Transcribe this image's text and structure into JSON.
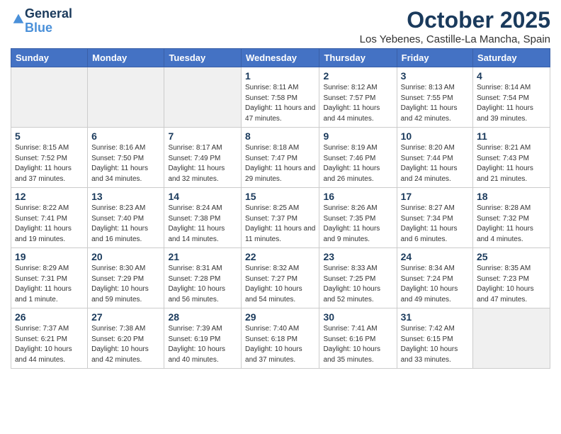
{
  "header": {
    "logo_line1": "General",
    "logo_line2": "Blue",
    "month": "October 2025",
    "location": "Los Yebenes, Castille-La Mancha, Spain"
  },
  "weekdays": [
    "Sunday",
    "Monday",
    "Tuesday",
    "Wednesday",
    "Thursday",
    "Friday",
    "Saturday"
  ],
  "weeks": [
    [
      {
        "day": "",
        "sunrise": "",
        "sunset": "",
        "daylight": "",
        "empty": true
      },
      {
        "day": "",
        "sunrise": "",
        "sunset": "",
        "daylight": "",
        "empty": true
      },
      {
        "day": "",
        "sunrise": "",
        "sunset": "",
        "daylight": "",
        "empty": true
      },
      {
        "day": "1",
        "sunrise": "Sunrise: 8:11 AM",
        "sunset": "Sunset: 7:58 PM",
        "daylight": "Daylight: 11 hours and 47 minutes.",
        "empty": false
      },
      {
        "day": "2",
        "sunrise": "Sunrise: 8:12 AM",
        "sunset": "Sunset: 7:57 PM",
        "daylight": "Daylight: 11 hours and 44 minutes.",
        "empty": false
      },
      {
        "day": "3",
        "sunrise": "Sunrise: 8:13 AM",
        "sunset": "Sunset: 7:55 PM",
        "daylight": "Daylight: 11 hours and 42 minutes.",
        "empty": false
      },
      {
        "day": "4",
        "sunrise": "Sunrise: 8:14 AM",
        "sunset": "Sunset: 7:54 PM",
        "daylight": "Daylight: 11 hours and 39 minutes.",
        "empty": false
      }
    ],
    [
      {
        "day": "5",
        "sunrise": "Sunrise: 8:15 AM",
        "sunset": "Sunset: 7:52 PM",
        "daylight": "Daylight: 11 hours and 37 minutes.",
        "empty": false
      },
      {
        "day": "6",
        "sunrise": "Sunrise: 8:16 AM",
        "sunset": "Sunset: 7:50 PM",
        "daylight": "Daylight: 11 hours and 34 minutes.",
        "empty": false
      },
      {
        "day": "7",
        "sunrise": "Sunrise: 8:17 AM",
        "sunset": "Sunset: 7:49 PM",
        "daylight": "Daylight: 11 hours and 32 minutes.",
        "empty": false
      },
      {
        "day": "8",
        "sunrise": "Sunrise: 8:18 AM",
        "sunset": "Sunset: 7:47 PM",
        "daylight": "Daylight: 11 hours and 29 minutes.",
        "empty": false
      },
      {
        "day": "9",
        "sunrise": "Sunrise: 8:19 AM",
        "sunset": "Sunset: 7:46 PM",
        "daylight": "Daylight: 11 hours and 26 minutes.",
        "empty": false
      },
      {
        "day": "10",
        "sunrise": "Sunrise: 8:20 AM",
        "sunset": "Sunset: 7:44 PM",
        "daylight": "Daylight: 11 hours and 24 minutes.",
        "empty": false
      },
      {
        "day": "11",
        "sunrise": "Sunrise: 8:21 AM",
        "sunset": "Sunset: 7:43 PM",
        "daylight": "Daylight: 11 hours and 21 minutes.",
        "empty": false
      }
    ],
    [
      {
        "day": "12",
        "sunrise": "Sunrise: 8:22 AM",
        "sunset": "Sunset: 7:41 PM",
        "daylight": "Daylight: 11 hours and 19 minutes.",
        "empty": false
      },
      {
        "day": "13",
        "sunrise": "Sunrise: 8:23 AM",
        "sunset": "Sunset: 7:40 PM",
        "daylight": "Daylight: 11 hours and 16 minutes.",
        "empty": false
      },
      {
        "day": "14",
        "sunrise": "Sunrise: 8:24 AM",
        "sunset": "Sunset: 7:38 PM",
        "daylight": "Daylight: 11 hours and 14 minutes.",
        "empty": false
      },
      {
        "day": "15",
        "sunrise": "Sunrise: 8:25 AM",
        "sunset": "Sunset: 7:37 PM",
        "daylight": "Daylight: 11 hours and 11 minutes.",
        "empty": false
      },
      {
        "day": "16",
        "sunrise": "Sunrise: 8:26 AM",
        "sunset": "Sunset: 7:35 PM",
        "daylight": "Daylight: 11 hours and 9 minutes.",
        "empty": false
      },
      {
        "day": "17",
        "sunrise": "Sunrise: 8:27 AM",
        "sunset": "Sunset: 7:34 PM",
        "daylight": "Daylight: 11 hours and 6 minutes.",
        "empty": false
      },
      {
        "day": "18",
        "sunrise": "Sunrise: 8:28 AM",
        "sunset": "Sunset: 7:32 PM",
        "daylight": "Daylight: 11 hours and 4 minutes.",
        "empty": false
      }
    ],
    [
      {
        "day": "19",
        "sunrise": "Sunrise: 8:29 AM",
        "sunset": "Sunset: 7:31 PM",
        "daylight": "Daylight: 11 hours and 1 minute.",
        "empty": false
      },
      {
        "day": "20",
        "sunrise": "Sunrise: 8:30 AM",
        "sunset": "Sunset: 7:29 PM",
        "daylight": "Daylight: 10 hours and 59 minutes.",
        "empty": false
      },
      {
        "day": "21",
        "sunrise": "Sunrise: 8:31 AM",
        "sunset": "Sunset: 7:28 PM",
        "daylight": "Daylight: 10 hours and 56 minutes.",
        "empty": false
      },
      {
        "day": "22",
        "sunrise": "Sunrise: 8:32 AM",
        "sunset": "Sunset: 7:27 PM",
        "daylight": "Daylight: 10 hours and 54 minutes.",
        "empty": false
      },
      {
        "day": "23",
        "sunrise": "Sunrise: 8:33 AM",
        "sunset": "Sunset: 7:25 PM",
        "daylight": "Daylight: 10 hours and 52 minutes.",
        "empty": false
      },
      {
        "day": "24",
        "sunrise": "Sunrise: 8:34 AM",
        "sunset": "Sunset: 7:24 PM",
        "daylight": "Daylight: 10 hours and 49 minutes.",
        "empty": false
      },
      {
        "day": "25",
        "sunrise": "Sunrise: 8:35 AM",
        "sunset": "Sunset: 7:23 PM",
        "daylight": "Daylight: 10 hours and 47 minutes.",
        "empty": false
      }
    ],
    [
      {
        "day": "26",
        "sunrise": "Sunrise: 7:37 AM",
        "sunset": "Sunset: 6:21 PM",
        "daylight": "Daylight: 10 hours and 44 minutes.",
        "empty": false
      },
      {
        "day": "27",
        "sunrise": "Sunrise: 7:38 AM",
        "sunset": "Sunset: 6:20 PM",
        "daylight": "Daylight: 10 hours and 42 minutes.",
        "empty": false
      },
      {
        "day": "28",
        "sunrise": "Sunrise: 7:39 AM",
        "sunset": "Sunset: 6:19 PM",
        "daylight": "Daylight: 10 hours and 40 minutes.",
        "empty": false
      },
      {
        "day": "29",
        "sunrise": "Sunrise: 7:40 AM",
        "sunset": "Sunset: 6:18 PM",
        "daylight": "Daylight: 10 hours and 37 minutes.",
        "empty": false
      },
      {
        "day": "30",
        "sunrise": "Sunrise: 7:41 AM",
        "sunset": "Sunset: 6:16 PM",
        "daylight": "Daylight: 10 hours and 35 minutes.",
        "empty": false
      },
      {
        "day": "31",
        "sunrise": "Sunrise: 7:42 AM",
        "sunset": "Sunset: 6:15 PM",
        "daylight": "Daylight: 10 hours and 33 minutes.",
        "empty": false
      },
      {
        "day": "",
        "sunrise": "",
        "sunset": "",
        "daylight": "",
        "empty": true
      }
    ]
  ]
}
